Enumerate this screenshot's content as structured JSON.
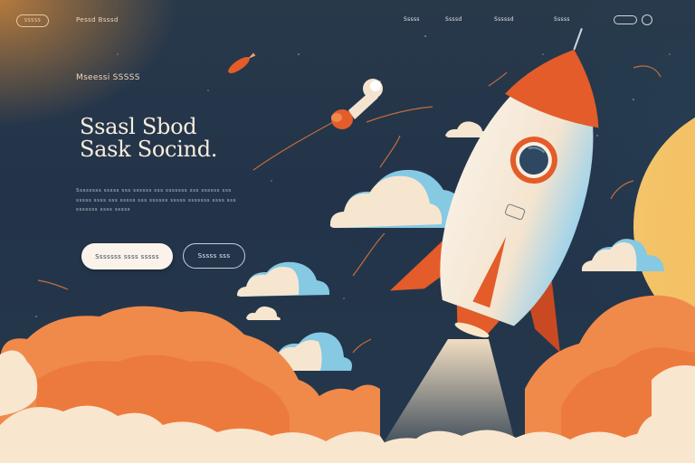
{
  "nav": {
    "logo_text": "SSSSS",
    "brand": "Pessd Bsssd",
    "links": [
      "Sssss",
      "Ssssd",
      "Sssssd",
      "Sssss"
    ],
    "icon": "user-icon"
  },
  "hero": {
    "eyebrow": "Mseessi SSSSS",
    "title_line1": "Ssasl Sbod",
    "title_line2": "Sask Socind.",
    "body": "Ssssssss sssss sss ssssss sss sssssss sss ssssss sss sssss ssss sss sssss sss ssssss sssss sssssss ssss sss sssssss ssss sssss",
    "primary_button": "Sssssss ssss sssss",
    "secondary_button": "Sssss sss"
  },
  "colors": {
    "sky": "#24374b",
    "cloud_orange": "#f08a4b",
    "cloud_cream": "#fbe8d0",
    "rocket_body": "#f4e9da",
    "rocket_accent": "#e35c2a",
    "accent_blue": "#7ec4e0"
  }
}
